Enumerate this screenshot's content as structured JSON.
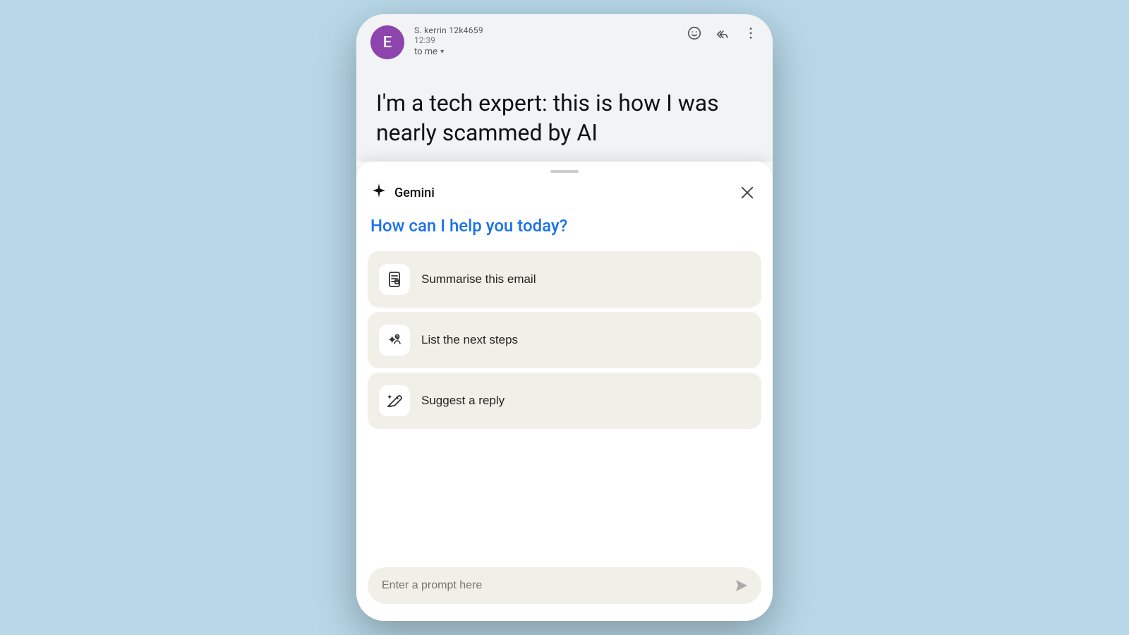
{
  "background": {
    "color": "#b8d8e8"
  },
  "phone": {
    "email": {
      "avatar_letter": "E",
      "avatar_color": "#8e44ad",
      "sender_name": "S. kerrin  12k4659",
      "time": "12:39",
      "recipient": "to me",
      "email_title": "I'm a tech expert: this is how I was nearly scammed by AI"
    },
    "gemini_panel": {
      "handle_visible": true,
      "title": "Gemini",
      "help_text": "How can I help you today?",
      "close_label": "×",
      "actions": [
        {
          "id": "summarise",
          "label": "Summarise this email",
          "icon": "document-icon"
        },
        {
          "id": "next-steps",
          "label": "List the next steps",
          "icon": "list-icon"
        },
        {
          "id": "suggest-reply",
          "label": "Suggest a reply",
          "icon": "pen-icon"
        }
      ],
      "prompt_placeholder": "Enter a prompt here"
    }
  }
}
